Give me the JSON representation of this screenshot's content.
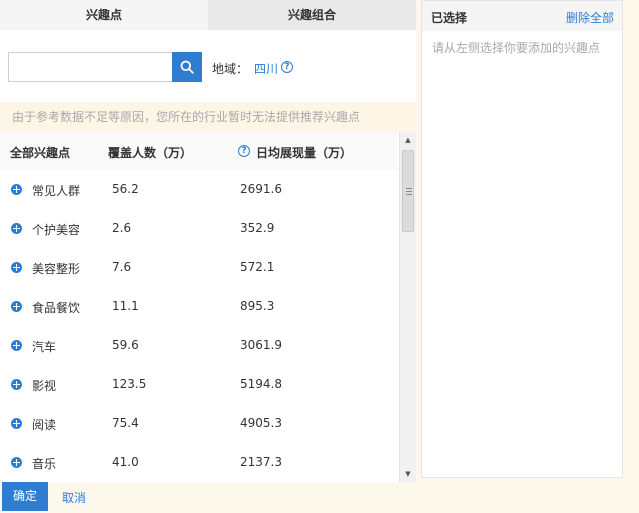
{
  "tabs": [
    {
      "label": "兴趣点",
      "active": true
    },
    {
      "label": "兴趣组合",
      "active": false
    }
  ],
  "search": {
    "value": "",
    "placeholder": ""
  },
  "region": {
    "label": "地域：",
    "value": "四川"
  },
  "notice": "由于参考数据不足等原因，您所在的行业暂时无法提供推荐兴趣点",
  "table": {
    "headers": {
      "name": "全部兴趣点",
      "cover": "覆盖人数（万）",
      "views": "日均展现量（万）"
    },
    "rows": [
      {
        "name": "常见人群",
        "cover": "56.2",
        "views": "2691.6"
      },
      {
        "name": "个护美容",
        "cover": "2.6",
        "views": "352.9"
      },
      {
        "name": "美容整形",
        "cover": "7.6",
        "views": "572.1"
      },
      {
        "name": "食品餐饮",
        "cover": "11.1",
        "views": "895.3"
      },
      {
        "name": "汽车",
        "cover": "59.6",
        "views": "3061.9"
      },
      {
        "name": "影视",
        "cover": "123.5",
        "views": "5194.8"
      },
      {
        "name": "阅读",
        "cover": "75.4",
        "views": "4905.3"
      },
      {
        "name": "音乐",
        "cover": "41.0",
        "views": "2137.3"
      }
    ]
  },
  "selected_panel": {
    "title": "已选择",
    "clear_all": "删除全部",
    "placeholder": "请从左侧选择你要添加的兴趣点"
  },
  "footer": {
    "confirm": "确定",
    "cancel": "取消"
  },
  "colors": {
    "accent": "#2f7dd0",
    "notice_bg": "#fdf6e6"
  }
}
